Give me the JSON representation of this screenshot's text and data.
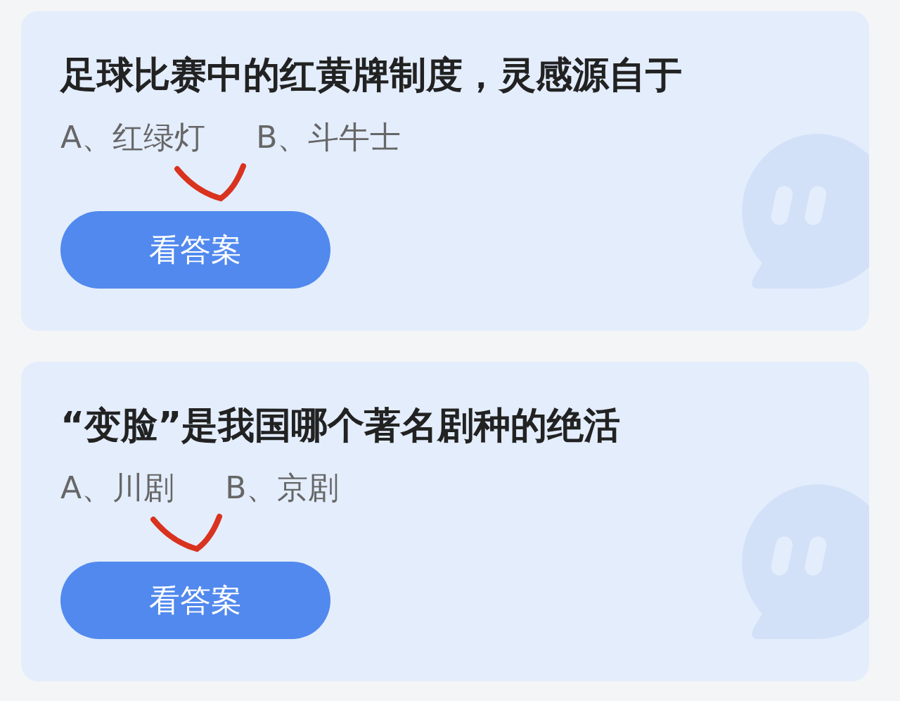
{
  "questions": [
    {
      "title": "足球比赛中的红黄牌制度，灵感源自于",
      "options": [
        {
          "label": "A、红绿灯",
          "marked": true
        },
        {
          "label": "B、斗牛士",
          "marked": false
        }
      ],
      "button": "看答案"
    },
    {
      "title": "“变脸”是我国哪个著名剧种的绝活",
      "options": [
        {
          "label": "A、川剧",
          "marked": true
        },
        {
          "label": "B、京剧",
          "marked": false
        }
      ],
      "button": "看答案"
    }
  ]
}
